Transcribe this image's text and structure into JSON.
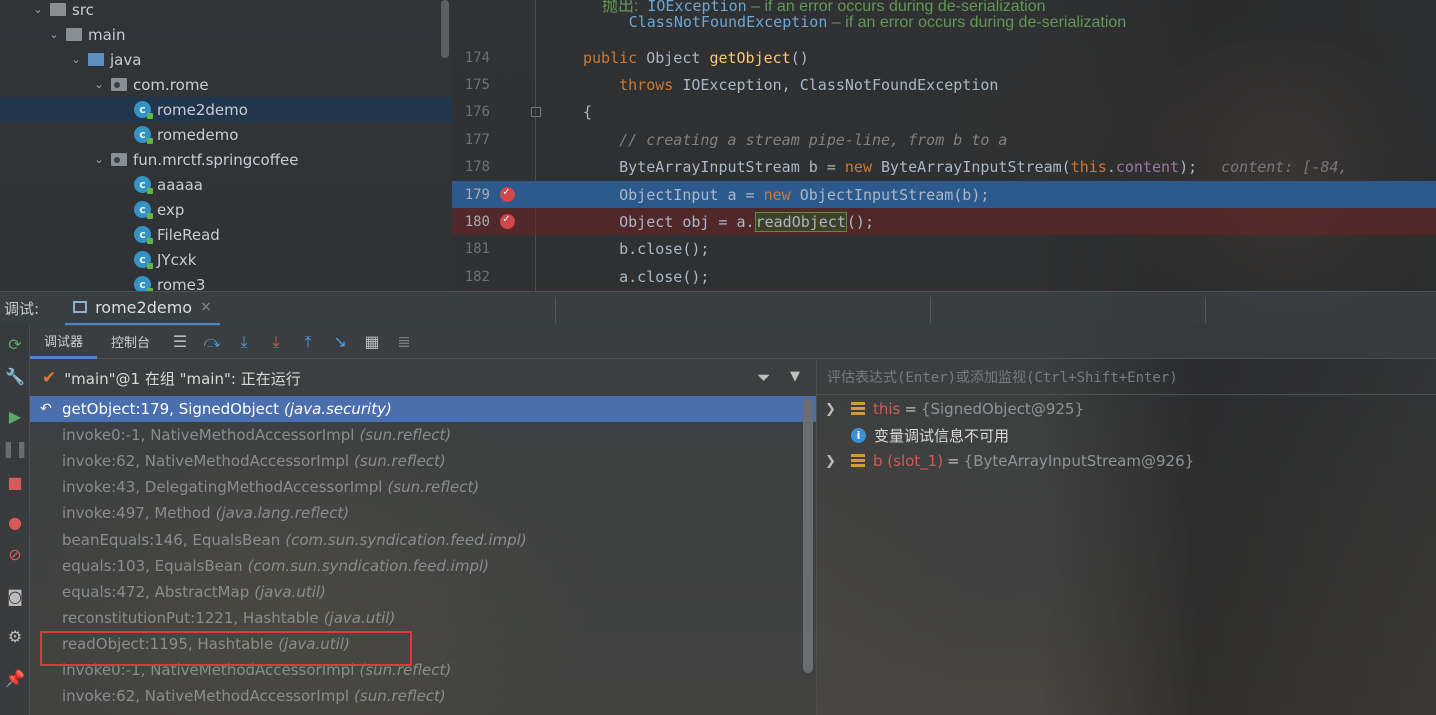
{
  "tree": {
    "items": [
      {
        "label": "src",
        "kind": "folder",
        "indent": 0,
        "chevron": "⌄"
      },
      {
        "label": "main",
        "kind": "folder",
        "indent": 1,
        "chevron": "⌄"
      },
      {
        "label": "java",
        "kind": "folder-blue",
        "indent": 2,
        "chevron": "⌄"
      },
      {
        "label": "com.rome",
        "kind": "package",
        "indent": 3,
        "chevron": "⌄"
      },
      {
        "label": "rome2demo",
        "kind": "class",
        "indent": 4,
        "selected": true
      },
      {
        "label": "romedemo",
        "kind": "class",
        "indent": 4
      },
      {
        "label": "fun.mrctf.springcoffee",
        "kind": "package",
        "indent": 3,
        "chevron": "⌄"
      },
      {
        "label": "aaaaa",
        "kind": "class",
        "indent": 4
      },
      {
        "label": "exp",
        "kind": "class",
        "indent": 4
      },
      {
        "label": "FileRead",
        "kind": "class",
        "indent": 4
      },
      {
        "label": "JYcxk",
        "kind": "class",
        "indent": 4
      },
      {
        "label": "rome3",
        "kind": "class",
        "indent": 4
      }
    ]
  },
  "editor": {
    "doc_lines": [
      {
        "prefix": "抛出:",
        "link": "IOException",
        "text": " – if an error occurs during de-serialization"
      },
      {
        "prefix": "",
        "link": "ClassNotFoundException",
        "text": " – if an error occurs during de-serialization"
      }
    ],
    "lines": [
      {
        "num": "174",
        "html": "<span class=\"kw\">public</span> Object <span class=\"fn\">getObject</span>()"
      },
      {
        "num": "175",
        "html": "    <span class=\"kw\">throws</span> IOException, ClassNotFoundException"
      },
      {
        "num": "176",
        "html": "{"
      },
      {
        "num": "177",
        "html": "    <span class=\"cm\">// creating a stream pipe-line, from b to a</span>"
      },
      {
        "num": "178",
        "html": "    ByteArrayInputStream b = <span class=\"kw\">new</span> ByteArrayInputStream(<span class=\"kw\">this</span>.<span class=\"fld\">content</span>);<span class=\"inline-hint\">content: [-84,</span>"
      },
      {
        "num": "179",
        "html": "    ObjectInput a = <span class=\"kw\">new</span> ObjectInputStream(b);",
        "state": "exec",
        "breakpoint": true
      },
      {
        "num": "180",
        "html": "    Object obj = a.<span class=\"boxed\">readObject</span>();",
        "state": "bp",
        "breakpoint": true
      },
      {
        "num": "181",
        "html": "    b.close();"
      },
      {
        "num": "182",
        "html": "    a.close();"
      }
    ]
  },
  "debug": {
    "title": "调试:",
    "session_tab": "rome2demo",
    "close_glyph": "×",
    "toolbar": {
      "tab_debugger": "调试器",
      "tab_console": "控制台"
    },
    "thread": "\"main\"@1 在组 \"main\": 正在运行",
    "frames": [
      {
        "method": "getObject:179, SignedObject",
        "pkg": "(java.security)",
        "current": true
      },
      {
        "method": "invoke0:-1, NativeMethodAccessorImpl",
        "pkg": "(sun.reflect)"
      },
      {
        "method": "invoke:62, NativeMethodAccessorImpl",
        "pkg": "(sun.reflect)"
      },
      {
        "method": "invoke:43, DelegatingMethodAccessorImpl",
        "pkg": "(sun.reflect)"
      },
      {
        "method": "invoke:497, Method",
        "pkg": "(java.lang.reflect)"
      },
      {
        "method": "beanEquals:146, EqualsBean",
        "pkg": "(com.sun.syndication.feed.impl)"
      },
      {
        "method": "equals:103, EqualsBean",
        "pkg": "(com.sun.syndication.feed.impl)"
      },
      {
        "method": "equals:472, AbstractMap",
        "pkg": "(java.util)"
      },
      {
        "method": "reconstitutionPut:1221, Hashtable",
        "pkg": "(java.util)"
      },
      {
        "method": "readObject:1195, Hashtable",
        "pkg": "(java.util)",
        "highlighted": true
      },
      {
        "method": "invoke0:-1, NativeMethodAccessorImpl",
        "pkg": "(sun.reflect)"
      },
      {
        "method": "invoke:62, NativeMethodAccessorImpl",
        "pkg": "(sun.reflect)"
      }
    ],
    "eval_placeholder": "评估表达式(Enter)或添加监视(Ctrl+Shift+Enter)",
    "variables": [
      {
        "kind": "var",
        "name": "this",
        "value": "{SignedObject@925}",
        "expandable": true
      },
      {
        "kind": "info",
        "message": "变量调试信息不可用"
      },
      {
        "kind": "var",
        "name": "b (slot_1)",
        "value": "{ByteArrayInputStream@926}",
        "expandable": true
      }
    ]
  },
  "colors": {
    "accent": "#4a88c7",
    "breakpoint": "#d0484b",
    "exec_line": "#2d5a8c",
    "current_frame": "#4b6eaf",
    "highlight_box": "#e0383a"
  }
}
